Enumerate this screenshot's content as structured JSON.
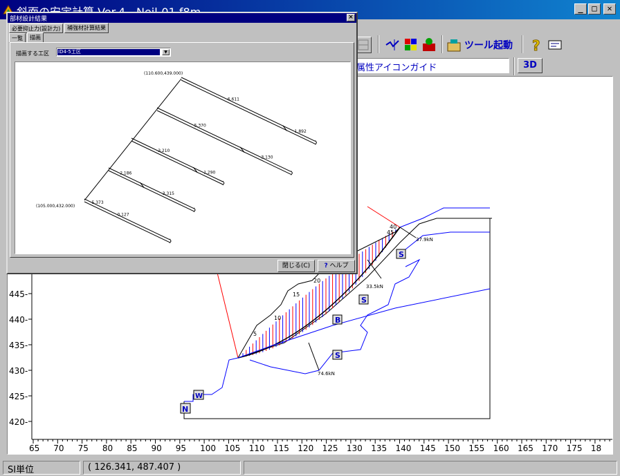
{
  "window": {
    "title": "斜面の安定計算 Ver.4 - Neil-01.f8m",
    "minimize": "_",
    "maximize": "□",
    "close": "✕"
  },
  "toolbar": {
    "tool_launch_label": "ツール起動",
    "attr_guide": "属性アイコンガイド",
    "btn_3d": "3D"
  },
  "status": {
    "units": "SI単位",
    "coords": "( 126.341, 487.407 )"
  },
  "dialog": {
    "title": "部材設計結果",
    "close": "×",
    "tabs": [
      "必要抑止力(設計力)",
      "補強材計算結果"
    ],
    "subtabs": [
      "一覧",
      "描画"
    ],
    "select_label": "描画する工区",
    "select_value": "ID4-5工区",
    "close_button": "閉じる(C)",
    "help_button": "ヘルプ",
    "drawing": {
      "top_label": "(110.600,439.000)",
      "bottom_label": "(105.000,432.000)",
      "nails": [
        {
          "length1": "6.611",
          "length2": "1.892"
        },
        {
          "length1": "5.370",
          "length2": "3.130"
        },
        {
          "length1": "3.210",
          "length2": "1.290"
        },
        {
          "length1": "2.186",
          "length2": "3.315"
        },
        {
          "length1": "0.127",
          "length2": "5.373"
        }
      ]
    }
  },
  "plot": {
    "x_ticks": [
      "65",
      "70",
      "75",
      "80",
      "85",
      "90",
      "95",
      "100",
      "105",
      "110",
      "115",
      "120",
      "125",
      "130",
      "135",
      "140",
      "145",
      "150",
      "155",
      "160",
      "165",
      "170",
      "175",
      "18"
    ],
    "y_ticks": [
      "445",
      "440",
      "435",
      "430",
      "425",
      "420"
    ],
    "slice_labels": [
      "45",
      "40",
      "20",
      "15",
      "10",
      "5"
    ],
    "force_labels": [
      "37.9kN",
      "33.5kN",
      "74.6kN"
    ],
    "zone_badges": [
      "S",
      "S",
      "B",
      "S",
      "W",
      "N"
    ],
    "colors": {
      "boundary": "#0000ff",
      "slip": "#ff0000",
      "outline": "#000000"
    }
  }
}
